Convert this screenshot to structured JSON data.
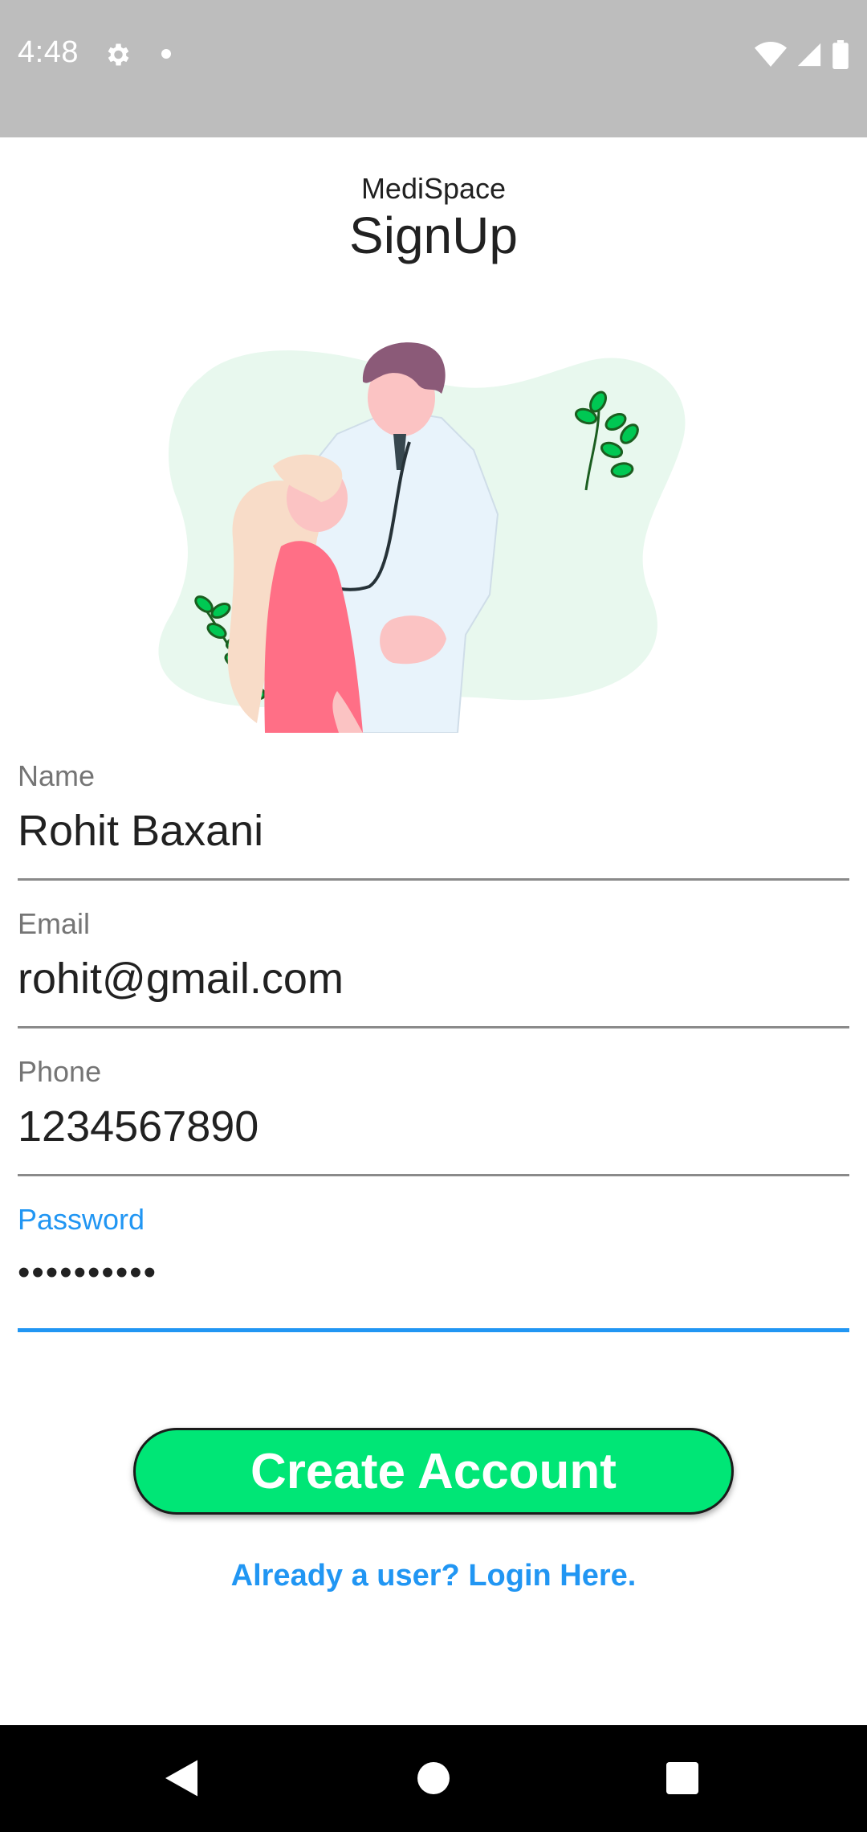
{
  "status_bar": {
    "time": "4:48",
    "icons": [
      "gear-icon",
      "dot-icon",
      "wifi-icon",
      "signal-icon",
      "battery-icon"
    ]
  },
  "header": {
    "app_name": "MediSpace",
    "title": "SignUp"
  },
  "illustration": {
    "name": "doctor-patient-illustration",
    "colors": {
      "blob": "#e8f8ee",
      "leaf": "#00c853",
      "doctor_coat": "#e8f3fb",
      "patient_shirt": "#ff6f86",
      "hair_doctor": "#8b5a78",
      "skin": "#fbc3c3"
    }
  },
  "form": {
    "name": {
      "label": "Name",
      "value": "Rohit Baxani"
    },
    "email": {
      "label": "Email",
      "value": "rohit@gmail.com"
    },
    "phone": {
      "label": "Phone",
      "value": "1234567890"
    },
    "password": {
      "label": "Password",
      "value": "••••••••••"
    }
  },
  "actions": {
    "create_account_label": "Create Account",
    "login_link": "Already a user? Login Here."
  },
  "colors": {
    "accent": "#2196f3",
    "button": "#00e676",
    "status_bar": "#bdbdbd",
    "nav_bar": "#000000"
  },
  "nav_bar": {
    "icons": [
      "back-icon",
      "home-icon",
      "recents-icon"
    ]
  }
}
